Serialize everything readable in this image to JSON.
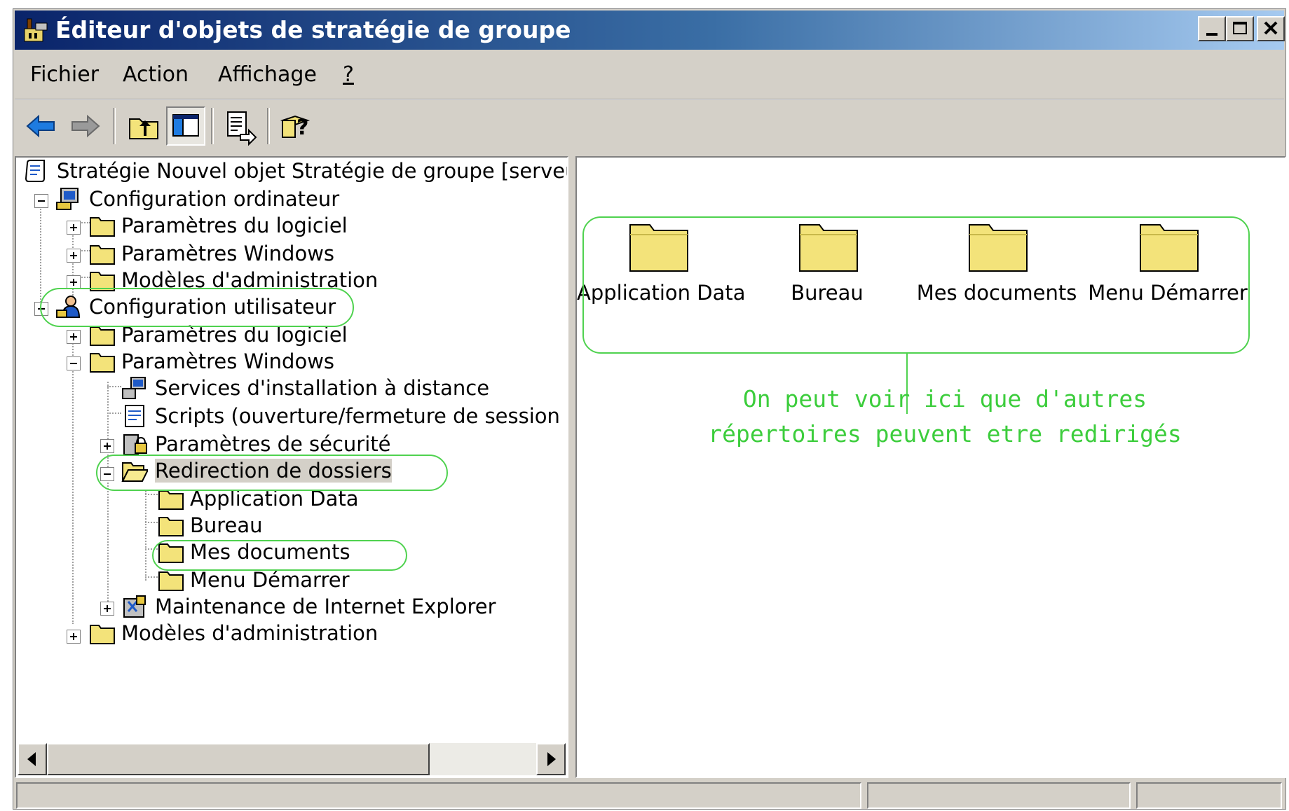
{
  "window": {
    "title": "Éditeur d'objets de stratégie de groupe"
  },
  "menu": [
    {
      "label": "Fichier"
    },
    {
      "label": "Action"
    },
    {
      "label": "Affichage"
    },
    {
      "label": "?"
    }
  ],
  "tree": {
    "root": "Stratégie Nouvel objet Stratégie de groupe [serveur",
    "computer_config": "Configuration ordinateur",
    "computer_children": [
      "Paramètres du logiciel",
      "Paramètres Windows",
      "Modèles d'administration"
    ],
    "user_config": "Configuration utilisateur",
    "user_software": "Paramètres du logiciel",
    "user_windows": "Paramètres Windows",
    "windows_children": [
      "Services d'installation à distance",
      "Scripts (ouverture/fermeture de session",
      "Paramètres de sécurité"
    ],
    "folder_redirection": "Redirection de dossiers",
    "redirection_children": [
      "Application Data",
      "Bureau",
      "Mes documents",
      "Menu Démarrer"
    ],
    "ie_maintenance": "Maintenance de Internet Explorer",
    "user_admin_templates": "Modèles d'administration"
  },
  "list": {
    "items": [
      "Application Data",
      "Bureau",
      "Mes documents",
      "Menu Démarrer"
    ]
  },
  "annotation": {
    "line1": "On peut voir ici que d'autres",
    "line2": "répertoires peuvent etre redirigés"
  },
  "colors": {
    "annotation": "#3ccd3c",
    "titlebar_start": "#0a246a",
    "titlebar_end": "#a6caf0",
    "face": "#d4d0c8"
  }
}
